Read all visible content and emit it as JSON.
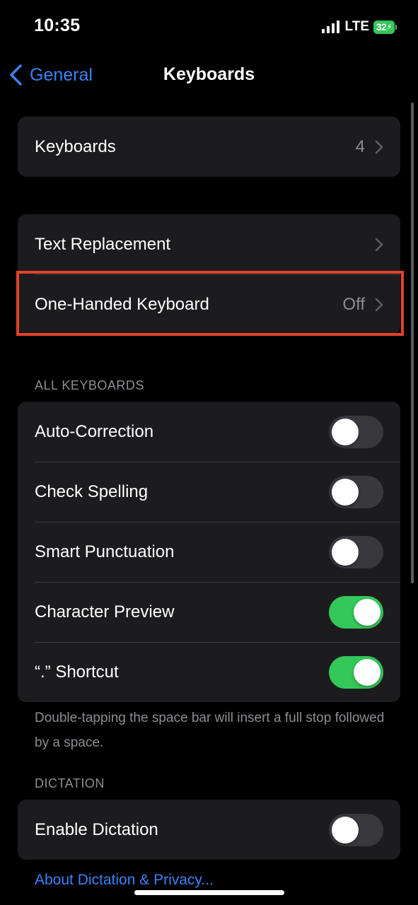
{
  "status_bar": {
    "time": "10:35",
    "network": "LTE",
    "battery_level": "32",
    "battery_color": "#34c759",
    "icons": [
      "signal-icon",
      "battery-charging-icon"
    ]
  },
  "nav": {
    "back_label": "General",
    "title": "Keyboards",
    "accent_color": "#3a82f7"
  },
  "keyboards_group": {
    "label": "Keyboards",
    "value": "4"
  },
  "options_group": {
    "text_replacement_label": "Text Replacement",
    "one_handed_label": "One-Handed Keyboard",
    "one_handed_value": "Off"
  },
  "all_keyboards": {
    "header": "ALL KEYBOARDS",
    "rows": [
      {
        "label": "Auto-Correction",
        "on": false
      },
      {
        "label": "Check Spelling",
        "on": false
      },
      {
        "label": "Smart Punctuation",
        "on": false
      },
      {
        "label": "Character Preview",
        "on": true
      },
      {
        "label": "“.” Shortcut",
        "on": true
      }
    ],
    "footer": "Double-tapping the space bar will insert a full stop followed by a space."
  },
  "dictation": {
    "header": "DICTATION",
    "enable_label": "Enable Dictation",
    "enable_on": false,
    "link": "About Dictation & Privacy..."
  },
  "highlight_color": "#e2432a"
}
